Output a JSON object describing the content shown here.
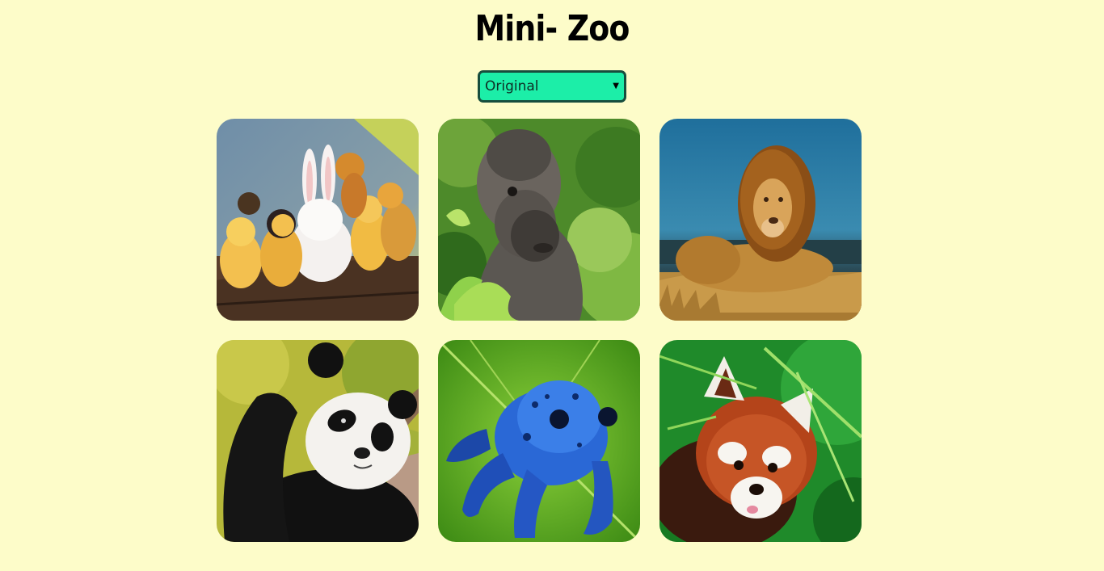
{
  "header": {
    "title": "Mini- Zoo"
  },
  "filter": {
    "selected": "Original"
  },
  "gallery": {
    "items": [
      {
        "animal": "rabbit-and-chicks"
      },
      {
        "animal": "gorilla"
      },
      {
        "animal": "lion"
      },
      {
        "animal": "panda"
      },
      {
        "animal": "blue-frog"
      },
      {
        "animal": "red-panda"
      }
    ]
  },
  "colors": {
    "background": "#fdfcc9",
    "select_fill": "#1ceea8",
    "select_border": "#174d3d"
  }
}
